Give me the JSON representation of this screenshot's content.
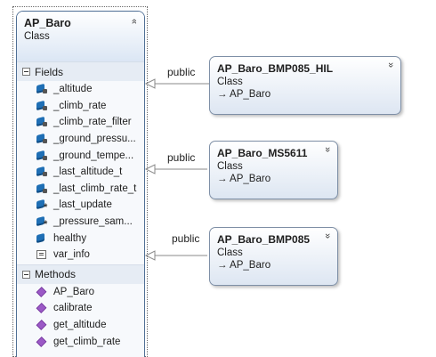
{
  "main_class": {
    "name": "AP_Baro",
    "stereotype": "Class",
    "collapse_glyph": "»",
    "fields_header": "Fields",
    "fields": [
      {
        "name": "_altitude",
        "icon": "private-field-icon"
      },
      {
        "name": "_climb_rate",
        "icon": "private-field-icon"
      },
      {
        "name": "_climb_rate_filter",
        "icon": "private-field-icon"
      },
      {
        "name": "_ground_pressu...",
        "icon": "private-field-icon"
      },
      {
        "name": "_ground_tempe...",
        "icon": "private-field-icon"
      },
      {
        "name": "_last_altitude_t",
        "icon": "private-field-icon"
      },
      {
        "name": "_last_climb_rate_t",
        "icon": "private-field-icon"
      },
      {
        "name": "_last_update",
        "icon": "protected-field-icon"
      },
      {
        "name": "_pressure_sam...",
        "icon": "protected-field-icon"
      },
      {
        "name": "healthy",
        "icon": "public-field-icon"
      },
      {
        "name": "var_info",
        "icon": "property-icon"
      }
    ],
    "methods_header": "Methods",
    "methods": [
      {
        "name": "AP_Baro",
        "icon": "method-icon"
      },
      {
        "name": "calibrate",
        "icon": "method-icon"
      },
      {
        "name": "get_altitude",
        "icon": "method-icon"
      },
      {
        "name": "get_climb_rate",
        "icon": "method-icon"
      }
    ]
  },
  "subclasses": [
    {
      "name": "AP_Baro_BMP085_HIL",
      "stereotype": "Class",
      "base": "→ AP_Baro",
      "relation": "public",
      "expand_glyph": "»"
    },
    {
      "name": "AP_Baro_MS5611",
      "stereotype": "Class",
      "base": "→ AP_Baro",
      "relation": "public",
      "expand_glyph": "»"
    },
    {
      "name": "AP_Baro_BMP085",
      "stereotype": "Class",
      "base": "→ AP_Baro",
      "relation": "public",
      "expand_glyph": "»"
    }
  ]
}
